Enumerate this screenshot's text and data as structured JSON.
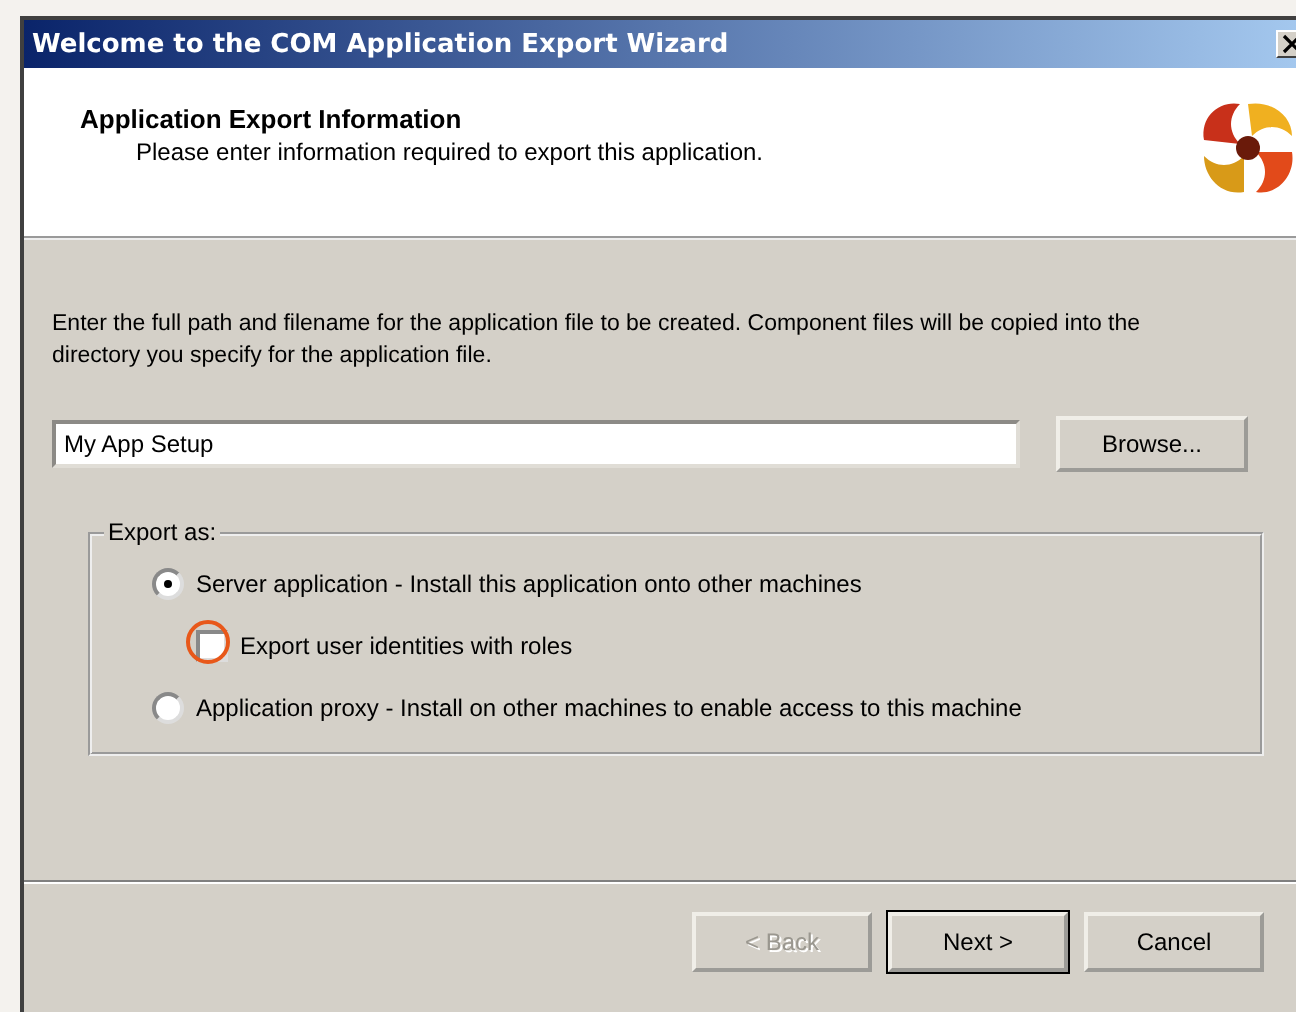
{
  "window": {
    "title": "Welcome to the COM Application Export Wizard"
  },
  "header": {
    "title": "Application Export Information",
    "subtitle": "Please enter information required to export this application."
  },
  "instructions": "Enter the full path and filename for the application file to be created.  Component files will be copied into the directory you specify for the application file.",
  "path_field": {
    "value": "My App Setup"
  },
  "browse_button": "Browse...",
  "export_group": {
    "label": "Export as:",
    "options": [
      {
        "kind": "radio",
        "label": "Server application - Install this application onto other machines",
        "selected": true
      },
      {
        "kind": "checkbox",
        "label": "Export user identities with roles",
        "checked": false,
        "highlighted": true
      },
      {
        "kind": "radio",
        "label": "Application proxy - Install on other machines to enable access to this machine",
        "selected": false
      }
    ]
  },
  "buttons": [
    {
      "label": "< Back",
      "disabled": true,
      "default": false
    },
    {
      "label": "Next >",
      "disabled": false,
      "default": true
    },
    {
      "label": "Cancel",
      "disabled": false,
      "default": false
    }
  ]
}
